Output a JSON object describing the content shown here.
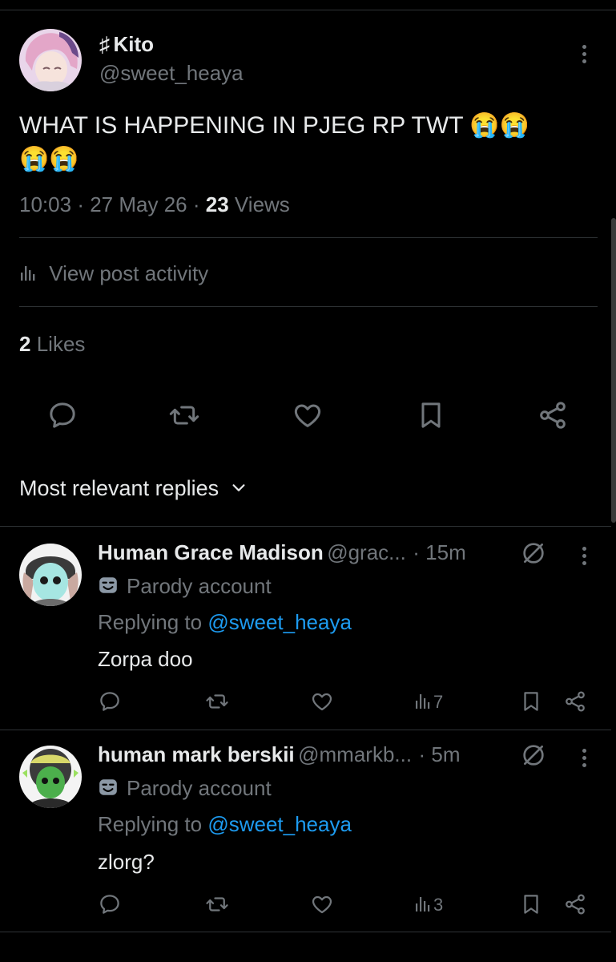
{
  "post": {
    "display_name": "Kito",
    "name_prefix": "♯",
    "handle": "@sweet_heaya",
    "text": "WHAT IS HAPPENING IN PJEG RP TWT",
    "emoji_line1": "😭😭",
    "emoji_line2": "😭😭",
    "time": "10:03",
    "date": "27 May 26",
    "views_count": "23",
    "views_label": "Views",
    "sep": "·",
    "activity_label": "View post activity",
    "likes_count": "2",
    "likes_label": "Likes"
  },
  "replies_sort": {
    "label": "Most relevant replies"
  },
  "replies": [
    {
      "display_name": "Human Grace Madison",
      "handle": "@grac...",
      "age": "· 15m",
      "parody_label": "Parody account",
      "replying_prefix": "Replying to",
      "replying_to": "@sweet_heaya",
      "text": "Zorpa doo",
      "views": "7"
    },
    {
      "display_name": "human mark berskii",
      "handle": "@mmarkb...",
      "age": "· 5m",
      "parody_label": "Parody account",
      "replying_prefix": "Replying to",
      "replying_to": "@sweet_heaya",
      "text": "zlorg?",
      "views": "3"
    }
  ],
  "icons": [
    "reply-icon",
    "retweet-icon",
    "like-icon",
    "bookmark-icon",
    "share-icon",
    "analytics-icon",
    "grok-icon",
    "parody-mask-icon",
    "chevron-down-icon",
    "more-icon"
  ],
  "colors": {
    "background": "#000000",
    "text": "#e7e9ea",
    "muted": "#71767b",
    "link": "#1d9bf0",
    "divider": "#2f3336"
  }
}
